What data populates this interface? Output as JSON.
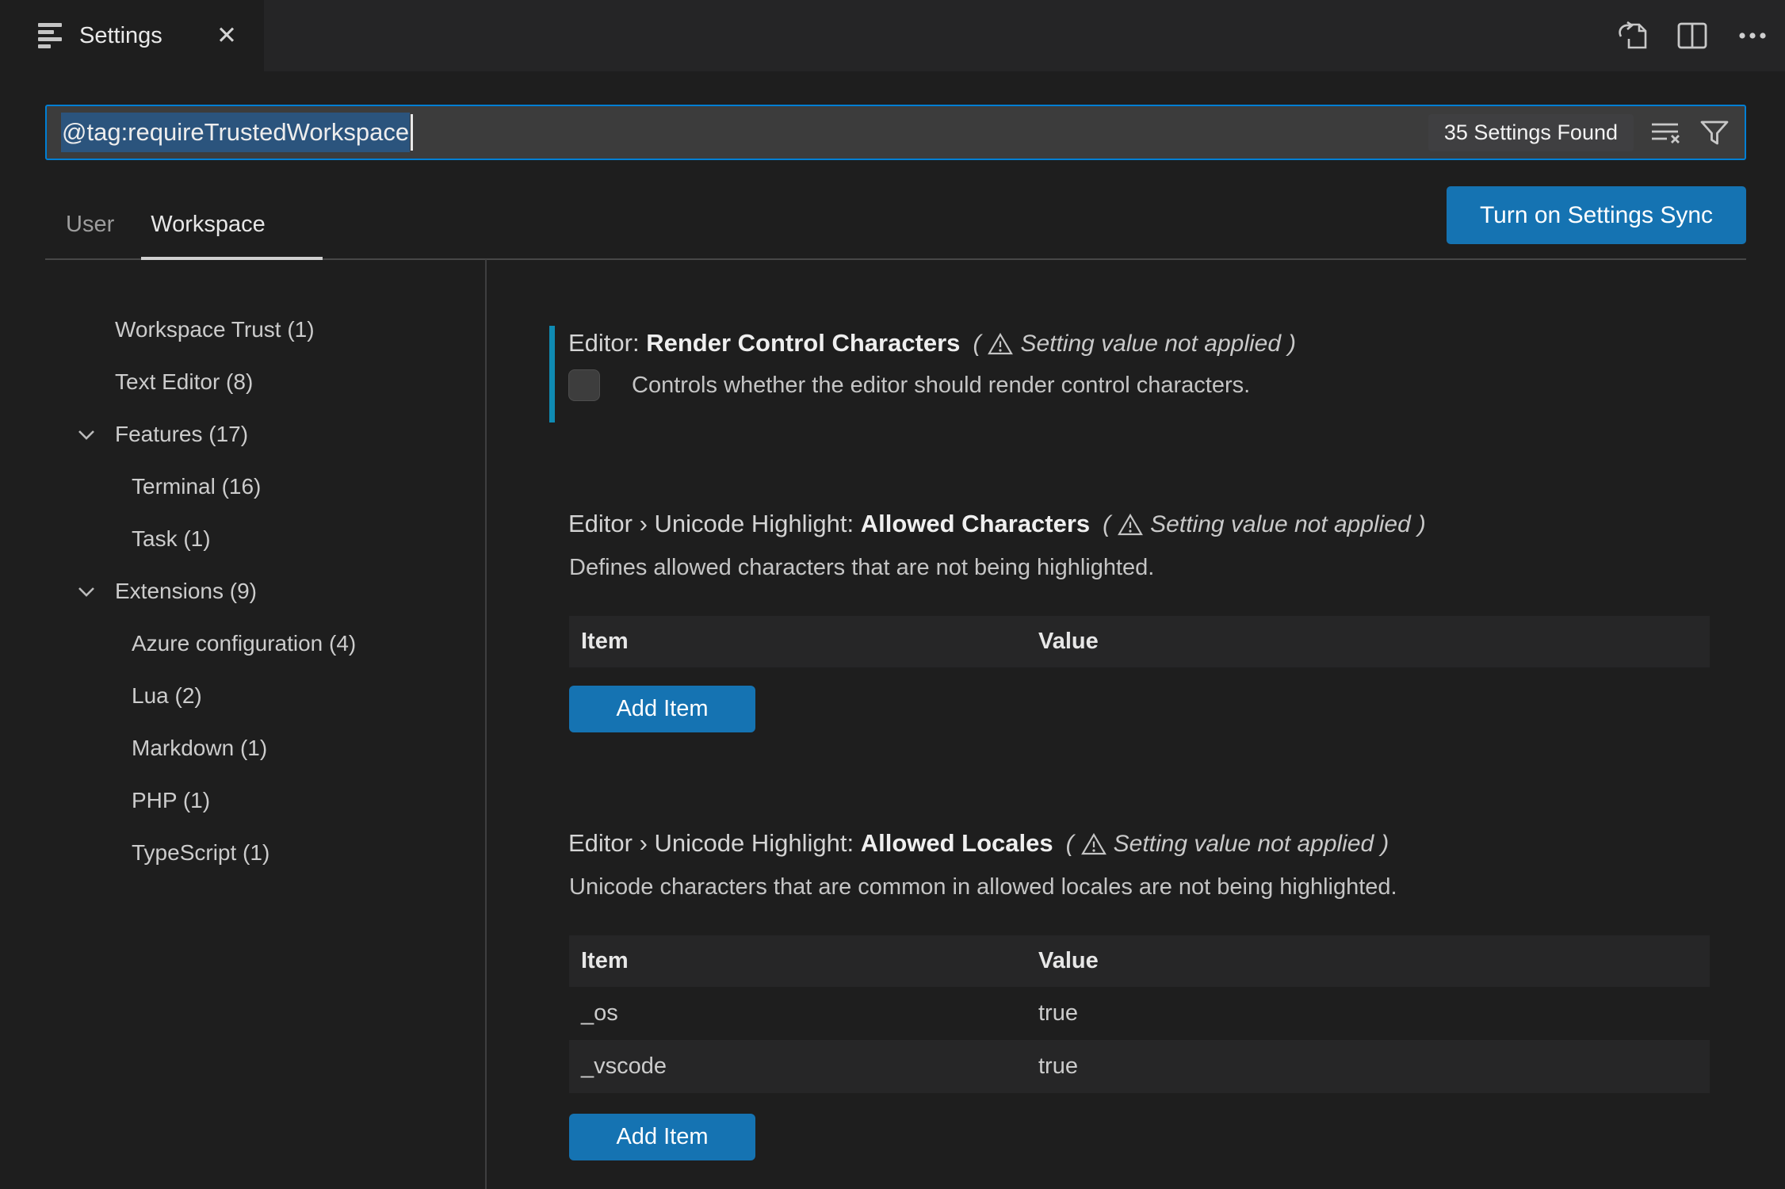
{
  "window": {
    "tab_title": "Settings"
  },
  "search": {
    "value": "@tag:requireTrustedWorkspace",
    "results_badge": "35 Settings Found"
  },
  "scope_tabs": [
    {
      "label": "User",
      "active": false
    },
    {
      "label": "Workspace",
      "active": true
    }
  ],
  "sync": {
    "label": "Turn on Settings Sync"
  },
  "toc": {
    "items": [
      {
        "label": "Workspace Trust (1)",
        "level": 0
      },
      {
        "label": "Text Editor (8)",
        "level": 0
      },
      {
        "label": "Features (17)",
        "level": 0,
        "expanded": true
      },
      {
        "label": "Terminal (16)",
        "level": 1
      },
      {
        "label": "Task (1)",
        "level": 1
      },
      {
        "label": "Extensions (9)",
        "level": 0,
        "expanded": true
      },
      {
        "label": "Azure configuration (4)",
        "level": 1
      },
      {
        "label": "Lua (2)",
        "level": 1
      },
      {
        "label": "Markdown (1)",
        "level": 1
      },
      {
        "label": "PHP (1)",
        "level": 1
      },
      {
        "label": "TypeScript (1)",
        "level": 1
      }
    ]
  },
  "warning": {
    "open": "(",
    "text": "Setting value not applied",
    "close": ")"
  },
  "settings": [
    {
      "category": "Editor: ",
      "name": "Render Control Characters",
      "description": "Controls whether the editor should render control characters.",
      "checked": false
    },
    {
      "category": "Editor › Unicode Highlight: ",
      "name": "Allowed Characters",
      "description": "Defines allowed characters that are not being highlighted.",
      "table": {
        "columns": [
          "Item",
          "Value"
        ],
        "rows": []
      },
      "add_button": "Add Item"
    },
    {
      "category": "Editor › Unicode Highlight: ",
      "name": "Allowed Locales",
      "description": "Unicode characters that are common in allowed locales are not being highlighted.",
      "table": {
        "columns": [
          "Item",
          "Value"
        ],
        "rows": [
          {
            "item": "_os",
            "value": "true"
          },
          {
            "item": "_vscode",
            "value": "true"
          }
        ]
      },
      "add_button": "Add Item"
    }
  ],
  "colors": {
    "focus_border": "#007fd4",
    "button_blue": "#1573b2",
    "modified_indicator": "#0f8bb3",
    "text_selection": "#2b547d",
    "tabstrip_bg": "#252526",
    "page_bg": "#1e1e1e"
  }
}
